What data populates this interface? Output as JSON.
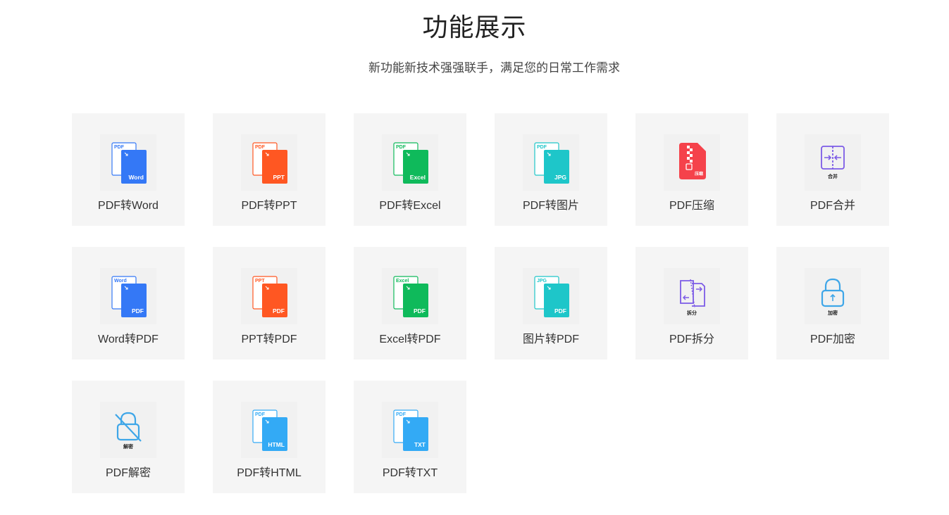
{
  "header": {
    "title": "功能展示",
    "subtitle": "新功能新技术强强联手，满足您的日常工作需求"
  },
  "colors": {
    "blue": "#3478f6",
    "orange": "#ff5722",
    "green": "#0fba5b",
    "teal": "#1ec6c9",
    "red": "#f5424b",
    "purple": "#7c5be6",
    "sky": "#33aaf5",
    "lockblue": "#3ea6e8",
    "card_bg": "#f5f5f5"
  },
  "tools": [
    {
      "label": "PDF转Word",
      "icon": "pdf-to-word-icon",
      "src": "PDF",
      "dst": "Word",
      "color": "#3478f6"
    },
    {
      "label": "PDF转PPT",
      "icon": "pdf-to-ppt-icon",
      "src": "PDF",
      "dst": "PPT",
      "color": "#ff5722"
    },
    {
      "label": "PDF转Excel",
      "icon": "pdf-to-excel-icon",
      "src": "PDF",
      "dst": "Excel",
      "color": "#0fba5b"
    },
    {
      "label": "PDF转图片",
      "icon": "pdf-to-jpg-icon",
      "src": "PDF",
      "dst": "JPG",
      "color": "#1ec6c9"
    },
    {
      "label": "PDF压缩",
      "icon": "pdf-compress-icon",
      "badge": "压缩",
      "color": "#f5424b"
    },
    {
      "label": "PDF合并",
      "icon": "pdf-merge-icon",
      "badge": "合并",
      "color": "#7c5be6"
    },
    {
      "label": "Word转PDF",
      "icon": "word-to-pdf-icon",
      "src": "Word",
      "dst": "PDF",
      "color": "#3478f6"
    },
    {
      "label": "PPT转PDF",
      "icon": "ppt-to-pdf-icon",
      "src": "PPT",
      "dst": "PDF",
      "color": "#ff5722"
    },
    {
      "label": "Excel转PDF",
      "icon": "excel-to-pdf-icon",
      "src": "Excel",
      "dst": "PDF",
      "color": "#0fba5b"
    },
    {
      "label": "图片转PDF",
      "icon": "jpg-to-pdf-icon",
      "src": "JPG",
      "dst": "PDF",
      "color": "#1ec6c9"
    },
    {
      "label": "PDF拆分",
      "icon": "pdf-split-icon",
      "badge": "拆分",
      "color": "#7c5be6"
    },
    {
      "label": "PDF加密",
      "icon": "pdf-encrypt-lock-icon",
      "badge": "加密",
      "color": "#3ea6e8"
    },
    {
      "label": "PDF解密",
      "icon": "pdf-decrypt-unlock-icon",
      "badge": "解密",
      "color": "#3ea6e8"
    },
    {
      "label": "PDF转HTML",
      "icon": "pdf-to-html-icon",
      "src": "PDF",
      "dst": "HTML",
      "color": "#33aaf5"
    },
    {
      "label": "PDF转TXT",
      "icon": "pdf-to-txt-icon",
      "src": "PDF",
      "dst": "TXT",
      "color": "#33aaf5"
    }
  ]
}
